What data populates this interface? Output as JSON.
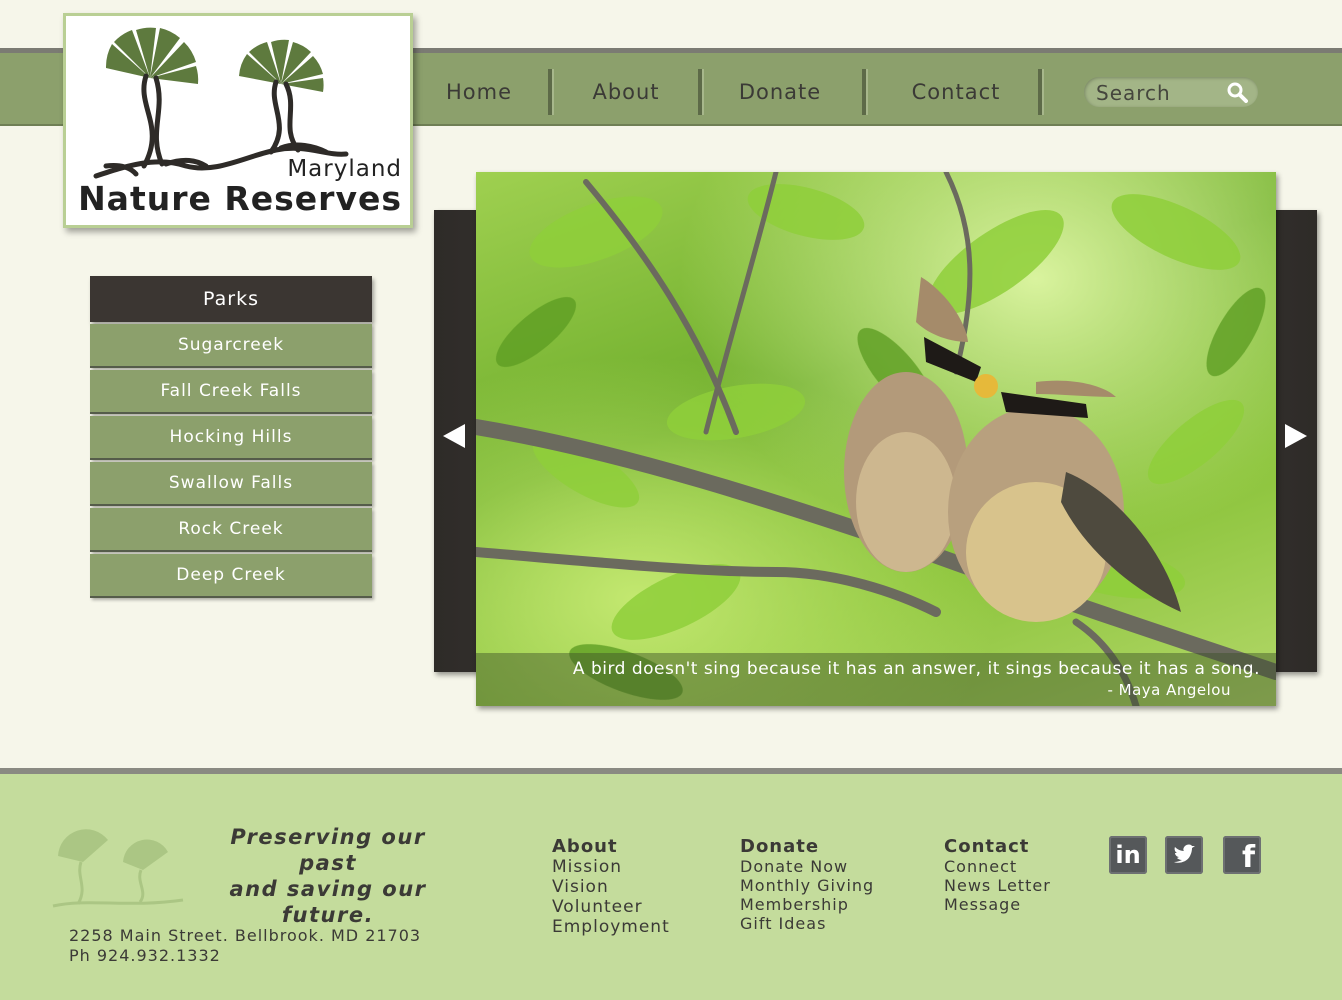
{
  "logo": {
    "line1": "Maryland",
    "line2": "Nature Reserves"
  },
  "nav": {
    "items": [
      "Home",
      "About",
      "Donate",
      "Contact"
    ],
    "search_placeholder": "Search"
  },
  "sidebar": {
    "title": "Parks",
    "items": [
      "Sugarcreek",
      "Fall Creek Falls",
      "Hocking Hills",
      "Swallow Falls",
      "Rock Creek",
      "Deep Creek"
    ]
  },
  "slider": {
    "quote": "A bird doesn't sing because it has an answer, it sings because it has a song.",
    "author": "- Maya Angelou"
  },
  "footer": {
    "tagline_1": "Preserving our past",
    "tagline_2": "and saving our future.",
    "address": "2258 Main Street. Bellbrook. MD 21703",
    "phone": "Ph 924.932.1332",
    "about": {
      "title": "About",
      "links": [
        "Mission",
        "Vision",
        "Volunteer",
        "Employment"
      ]
    },
    "donate": {
      "title": "Donate",
      "links": [
        "Donate Now",
        "Monthly Giving",
        "Membership",
        "Gift Ideas"
      ]
    },
    "contact": {
      "title": "Contact",
      "links": [
        "Connect",
        "News Letter",
        "Message"
      ]
    },
    "social": [
      "linkedin-icon",
      "twitter-icon",
      "facebook-icon"
    ]
  },
  "colors": {
    "nav_green": "#8ca06c",
    "footer_green": "#c4dc9c",
    "sidebar_header": "#3b3632",
    "background": "#f6f6ea"
  }
}
